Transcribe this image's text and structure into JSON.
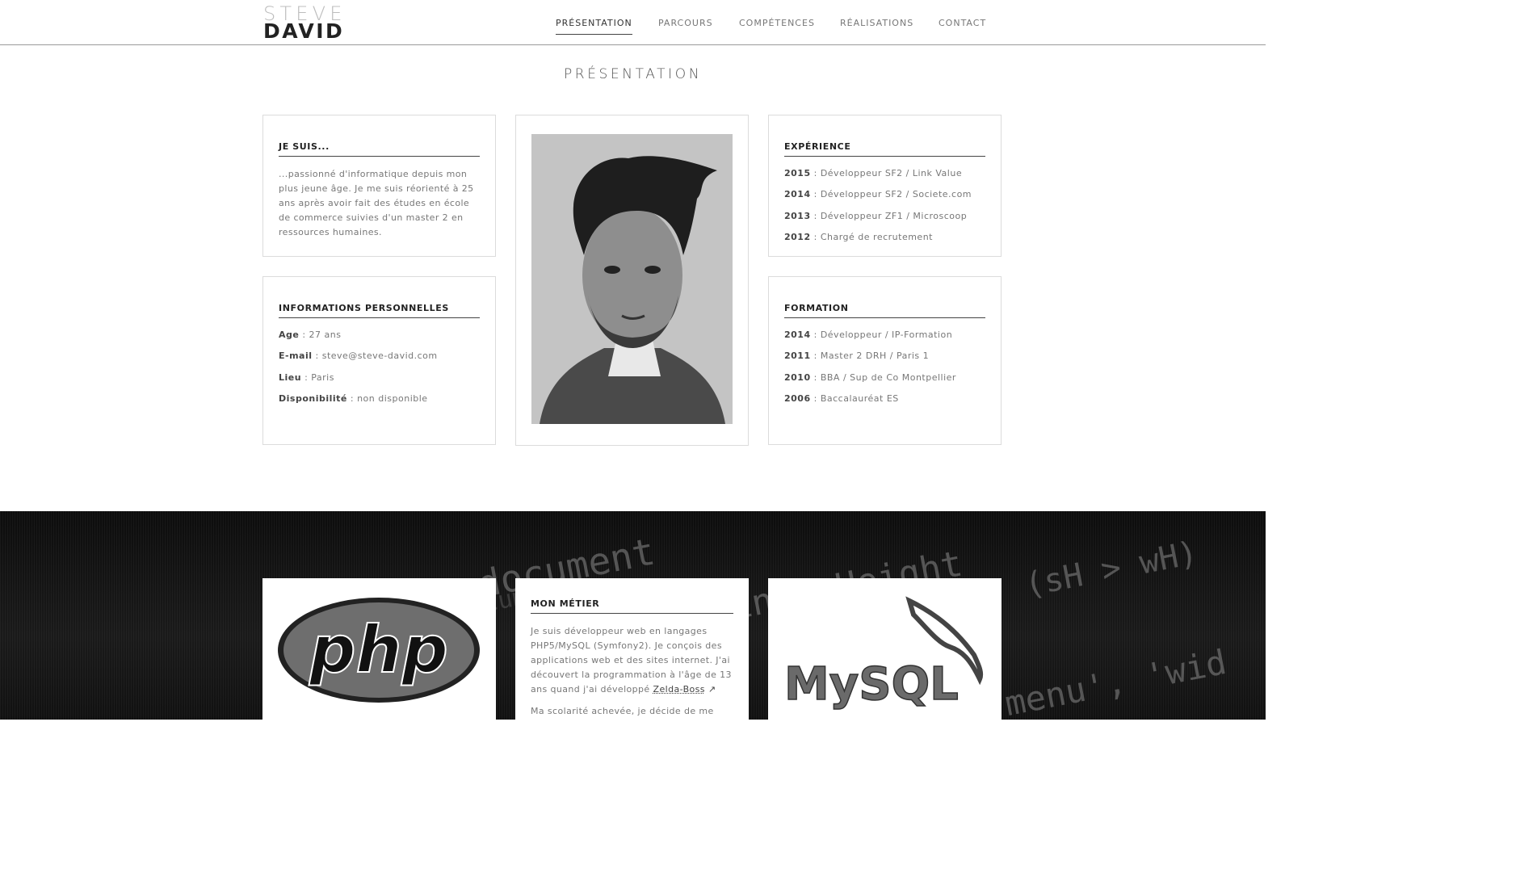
{
  "logo": {
    "first": "STEVE",
    "last": "DAVID"
  },
  "nav": {
    "items": [
      {
        "label": "PRÉSENTATION",
        "active": true
      },
      {
        "label": "PARCOURS",
        "active": false
      },
      {
        "label": "COMPÉTENCES",
        "active": false
      },
      {
        "label": "RÉALISATIONS",
        "active": false
      },
      {
        "label": "CONTACT",
        "active": false
      }
    ]
  },
  "section_title": "PRÉSENTATION",
  "je_suis": {
    "title": "JE SUIS...",
    "text": "...passionné d'informatique depuis mon plus jeune âge. Je me suis réorienté à 25 ans après avoir fait des études en école de commerce suivies d'un master 2 en ressources humaines."
  },
  "infos": {
    "title": "INFORMATIONS PERSONNELLES",
    "rows": [
      {
        "key": "Age",
        "value": " : 27 ans"
      },
      {
        "key": "E-mail",
        "value": " : steve@steve-david.com"
      },
      {
        "key": "Lieu",
        "value": " : Paris"
      },
      {
        "key": "Disponibilité",
        "value": " : non disponible"
      }
    ]
  },
  "experience": {
    "title": "EXPÉRIENCE",
    "rows": [
      {
        "key": "2015",
        "value": " : Développeur SF2 / Link Value"
      },
      {
        "key": "2014",
        "value": " : Développeur SF2 / Societe.com"
      },
      {
        "key": "2013",
        "value": " : Développeur ZF1 / Microscoop"
      },
      {
        "key": "2012",
        "value": " : Chargé de recrutement"
      }
    ]
  },
  "formation": {
    "title": "FORMATION",
    "rows": [
      {
        "key": "2014",
        "value": " : Développeur / IP-Formation"
      },
      {
        "key": "2011",
        "value": " : Master 2 DRH / Paris 1"
      },
      {
        "key": "2010",
        "value": " : BBA / Sup de Co Montpellier"
      },
      {
        "key": "2006",
        "value": " : Baccalauréat ES"
      }
    ]
  },
  "banner_code": {
    "line1": ".document",
    "line2": "innerHeight",
    "line3": "(sH > wH)",
    "line4": "document",
    "line5": "menu', 'wid"
  },
  "metier": {
    "title": "MON MÉTIER",
    "text_before": "Je suis développeur web en langages PHP5/MySQL (Symfony2). Je conçois des applications web et des sites internet. J'ai découvert la programmation à l'âge de 13 ans quand j'ai développé ",
    "link": "Zelda-Boss",
    "text_after": "Ma scolarité achevée, je décide de me"
  },
  "logos": {
    "php": "php",
    "mysql": "MySQL"
  }
}
